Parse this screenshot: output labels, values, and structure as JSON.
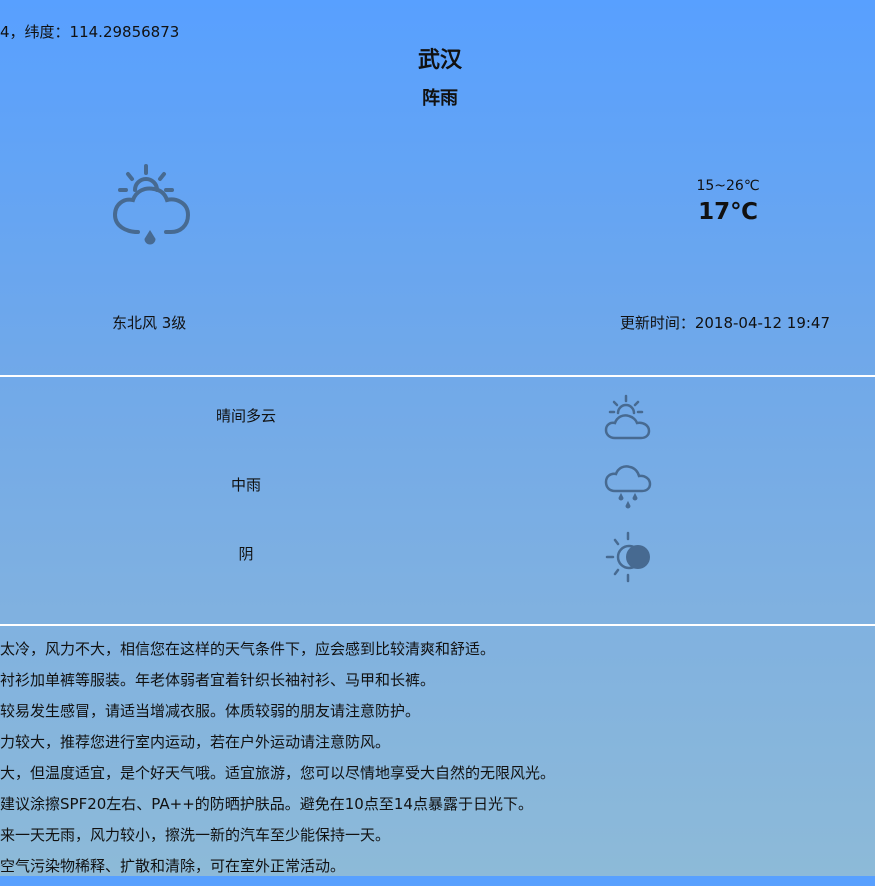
{
  "location": {
    "coords": "4，纬度：114.29856873",
    "city": "武汉",
    "condition": "阵雨"
  },
  "current": {
    "icon": "shower-rain-icon",
    "temp_range": "15~26℃",
    "temperature": "17℃",
    "wind": "东北风 3级",
    "update_time": "更新时间：2018-04-12 19:47"
  },
  "forecast": [
    {
      "label": "晴间多云",
      "icon": "partly-cloudy-icon"
    },
    {
      "label": "中雨",
      "icon": "moderate-rain-icon"
    },
    {
      "label": "阴",
      "icon": "overcast-icon"
    }
  ],
  "tips": [
    "太冷，风力不大，相信您在这样的天气条件下，应会感到比较清爽和舒适。",
    "衬衫加单裤等服装。年老体弱者宜着针织长袖衬衫、马甲和长裤。",
    "较易发生感冒，请适当增减衣服。体质较弱的朋友请注意防护。",
    "力较大，推荐您进行室内运动，若在户外运动请注意防风。",
    "大，但温度适宜，是个好天气哦。适宜旅游，您可以尽情地享受大自然的无限风光。",
    "建议涂擦SPF20左右、PA++的防晒护肤品。避免在10点至14点暴露于日光下。",
    "来一天无雨，风力较小，擦洗一新的汽车至少能保持一天。",
    "空气污染物稀释、扩散和清除，可在室外正常活动。"
  ],
  "colors": {
    "icon_stroke": "#476a91",
    "bg_top": "#58a0ff",
    "bg_bottom": "#8dbad8",
    "divider": "#ffffff"
  }
}
